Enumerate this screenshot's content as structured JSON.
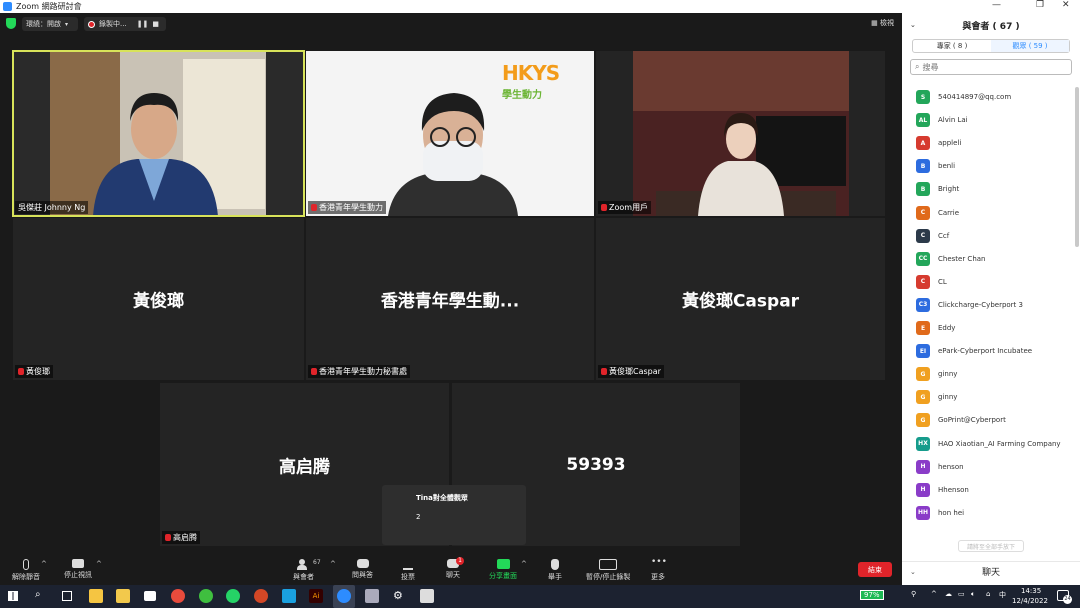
{
  "window": {
    "title": "Zoom 網路研討會"
  },
  "topbar": {
    "view_label": "環繞：開啟",
    "recording_label": "錄製中...",
    "gallery_label": "檢視"
  },
  "tiles": [
    {
      "name": "吳傑莊 Johnny Ng",
      "big": ""
    },
    {
      "name": "香港青年學生動力",
      "big": ""
    },
    {
      "name": "Zoom用戶",
      "big": ""
    },
    {
      "name": "黃俊瑯",
      "big": "黃俊瑯"
    },
    {
      "name": "香港青年學生動力秘書處",
      "big": "香港青年學生動..."
    },
    {
      "name": "黃俊瑯Caspar",
      "big": "黃俊瑯Caspar"
    },
    {
      "name": "高启腾",
      "big": "高启腾"
    },
    {
      "name": "",
      "big": "59393"
    }
  ],
  "video_content": {
    "logo_text": "HKYS",
    "logo_sub": "學生動力"
  },
  "popup": {
    "title": "Tina對全體觀眾",
    "message": "2"
  },
  "toolbar": {
    "unmute": "解除靜音",
    "stop_video": "停止視訊",
    "participants": "與會者",
    "participants_count": "67",
    "qa": "問與答",
    "polls": "投票",
    "chat": "聊天",
    "chat_badge": "1",
    "share": "分享畫面",
    "raise_hand": "舉手",
    "record": "暫停/停止錄製",
    "more": "更多",
    "end": "結束"
  },
  "panel": {
    "title": "與會者 ( 67 )",
    "tab_panelists": "專家 ( 8 )",
    "tab_attendees": "觀眾 ( 59 )",
    "search_placeholder": "搜尋",
    "invite_label": "請將至全部手放下",
    "chat_label": "聊天"
  },
  "participants": [
    {
      "initials": "S",
      "name": "540414897@qq.com",
      "color": "#23a65a"
    },
    {
      "initials": "AL",
      "name": "Alvin Lai",
      "color": "#23a65a"
    },
    {
      "initials": "A",
      "name": "appleli",
      "color": "#d63b2f"
    },
    {
      "initials": "B",
      "name": "benli",
      "color": "#2d6cdf"
    },
    {
      "initials": "B",
      "name": "Bright",
      "color": "#23a65a"
    },
    {
      "initials": "C",
      "name": "Carrie",
      "color": "#e06a1b"
    },
    {
      "initials": "C",
      "name": "Ccf",
      "color": "#2c3a4a"
    },
    {
      "initials": "CC",
      "name": "Chester Chan",
      "color": "#23a65a"
    },
    {
      "initials": "C",
      "name": "CL",
      "color": "#d63b2f"
    },
    {
      "initials": "C3",
      "name": "Clickcharge-Cyberport 3",
      "color": "#2d6cdf"
    },
    {
      "initials": "E",
      "name": "Eddy",
      "color": "#e06a1b"
    },
    {
      "initials": "EI",
      "name": "ePark-Cyberport Incubatee",
      "color": "#2d6cdf"
    },
    {
      "initials": "G",
      "name": "ginny",
      "color": "#f0a020"
    },
    {
      "initials": "G",
      "name": "ginny",
      "color": "#f0a020"
    },
    {
      "initials": "G",
      "name": "GoPrint@Cyberport",
      "color": "#f0a020"
    },
    {
      "initials": "HX",
      "name": "HAO Xiaotian_AI Farming Company",
      "color": "#169c8c"
    },
    {
      "initials": "H",
      "name": "henson",
      "color": "#8a3cc8"
    },
    {
      "initials": "H",
      "name": "Hhenson",
      "color": "#8a3cc8"
    },
    {
      "initials": "HH",
      "name": "hon hei",
      "color": "#8a3cc8"
    }
  ],
  "taskbar": {
    "battery": "97%",
    "ime": "中",
    "time": "14:35",
    "date": "12/4/2022",
    "notif": "24"
  }
}
